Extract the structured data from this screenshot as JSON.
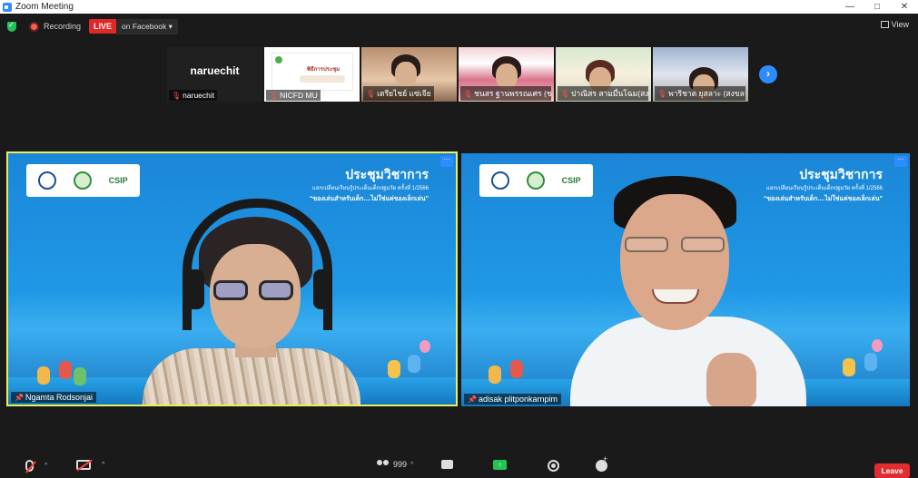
{
  "window": {
    "title": "Zoom Meeting",
    "controls": {
      "minimize": "—",
      "maximize": "□",
      "close": "✕"
    }
  },
  "topbar": {
    "recording_label": "Recording",
    "live_label": "LIVE",
    "facebook_label": "on Facebook",
    "view_label": "View"
  },
  "thumbnails": [
    {
      "name": "naruechit",
      "big_name": "naruechit",
      "type": "text"
    },
    {
      "name": "NICFD MU",
      "type": "slide",
      "slide_title": "พิธีการประชุม"
    },
    {
      "name": "เตรียไชย์ แซ่เจีย",
      "type": "video"
    },
    {
      "name": "ชนสร ฐานพรรณเศร (ชย...",
      "type": "video"
    },
    {
      "name": "ปาณิสร สามมื่นโฉม(สงขลา)",
      "type": "video"
    },
    {
      "name": "พาริชาต ยุสลาะ (สงขลา)",
      "type": "video"
    }
  ],
  "tiles": {
    "left": {
      "name": "Ngamta Rodsonjai",
      "conf_title": "ประชุมวิชาการ",
      "conf_sub": "แลกเปลี่ยนเรียนรู้ประเด็นเด็กปฐมวัย ครั้งที่ 1/2566",
      "conf_sub2": "“ของเล่นสำหรับเด็ก....ไม่ใช่แค่ของเล็กเล่น”",
      "logo_csip": "CSIP",
      "menu": "···"
    },
    "right": {
      "name": "adisak plitponkarnpim",
      "conf_title": "ประชุมวิชาการ",
      "conf_sub": "แลกเปลี่ยนเรียนรู้ประเด็นเด็กปฐมวัย ครั้งที่ 1/2566",
      "conf_sub2": "“ของเล่นสำหรับเด็ก....ไม่ใช่แค่ของเล็กเล่น”",
      "logo_csip": "CSIP",
      "menu": "···"
    }
  },
  "toolbar": {
    "participants_count": "999",
    "leave_label": "Leave",
    "caret": "^"
  },
  "colors": {
    "accent": "#2d8cff",
    "live": "#e02828",
    "leave": "#e02d2d",
    "speaker_border": "#e8f05a"
  }
}
